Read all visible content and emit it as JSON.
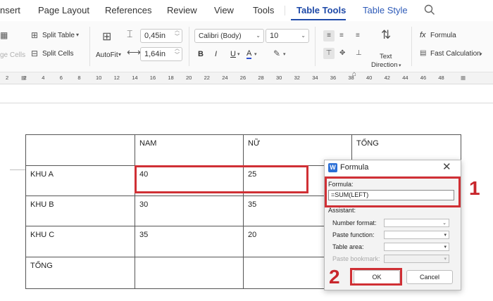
{
  "menubar": {
    "items": [
      "nsert",
      "Page Layout",
      "References",
      "Review",
      "View",
      "Tools",
      "Table Tools",
      "Table Style"
    ]
  },
  "ribbon": {
    "merge_cells": "ge Cells",
    "split_table": "Split Table",
    "split_cells": "Split Cells",
    "autofit": "AutoFit",
    "row_height": "0,45in",
    "col_width": "1,64in",
    "font_name": "Calibri (Body)",
    "font_size": "10",
    "text_direction_line1": "Text",
    "text_direction_line2": "Direction",
    "formula": "Formula",
    "fast_calculation": "Fast Calculation",
    "bold": "B",
    "italic": "I",
    "underline": "U",
    "font_color": "A",
    "fx": "fx"
  },
  "ruler": {
    "ticks": [
      "2",
      "2",
      "4",
      "6",
      "8",
      "10",
      "12",
      "14",
      "16",
      "18",
      "20",
      "22",
      "24",
      "26",
      "28",
      "30",
      "32",
      "34",
      "36",
      "38",
      "40",
      "42",
      "44",
      "46",
      "48"
    ]
  },
  "table": {
    "rows": [
      [
        "",
        "NAM",
        "NỮ",
        "TỔNG"
      ],
      [
        "KHU A",
        "40",
        "25",
        ""
      ],
      [
        "KHU B",
        "30",
        "35",
        ""
      ],
      [
        "KHU C",
        "35",
        "20",
        ""
      ],
      [
        "TỔNG",
        "",
        "",
        ""
      ]
    ]
  },
  "dialog": {
    "title": "Formula",
    "formula_label": "Formula:",
    "formula_value": "=SUM(LEFT)",
    "assistant_label": "Assistant:",
    "number_format": "Number format:",
    "paste_function": "Paste function:",
    "table_area": "Table area:",
    "paste_bookmark": "Paste bookmark:",
    "ok": "OK",
    "cancel": "Cancel"
  },
  "annotations": {
    "step1": "1",
    "step2": "2"
  },
  "colors": {
    "accent": "#1f4aa8",
    "highlight": "#d03035"
  }
}
